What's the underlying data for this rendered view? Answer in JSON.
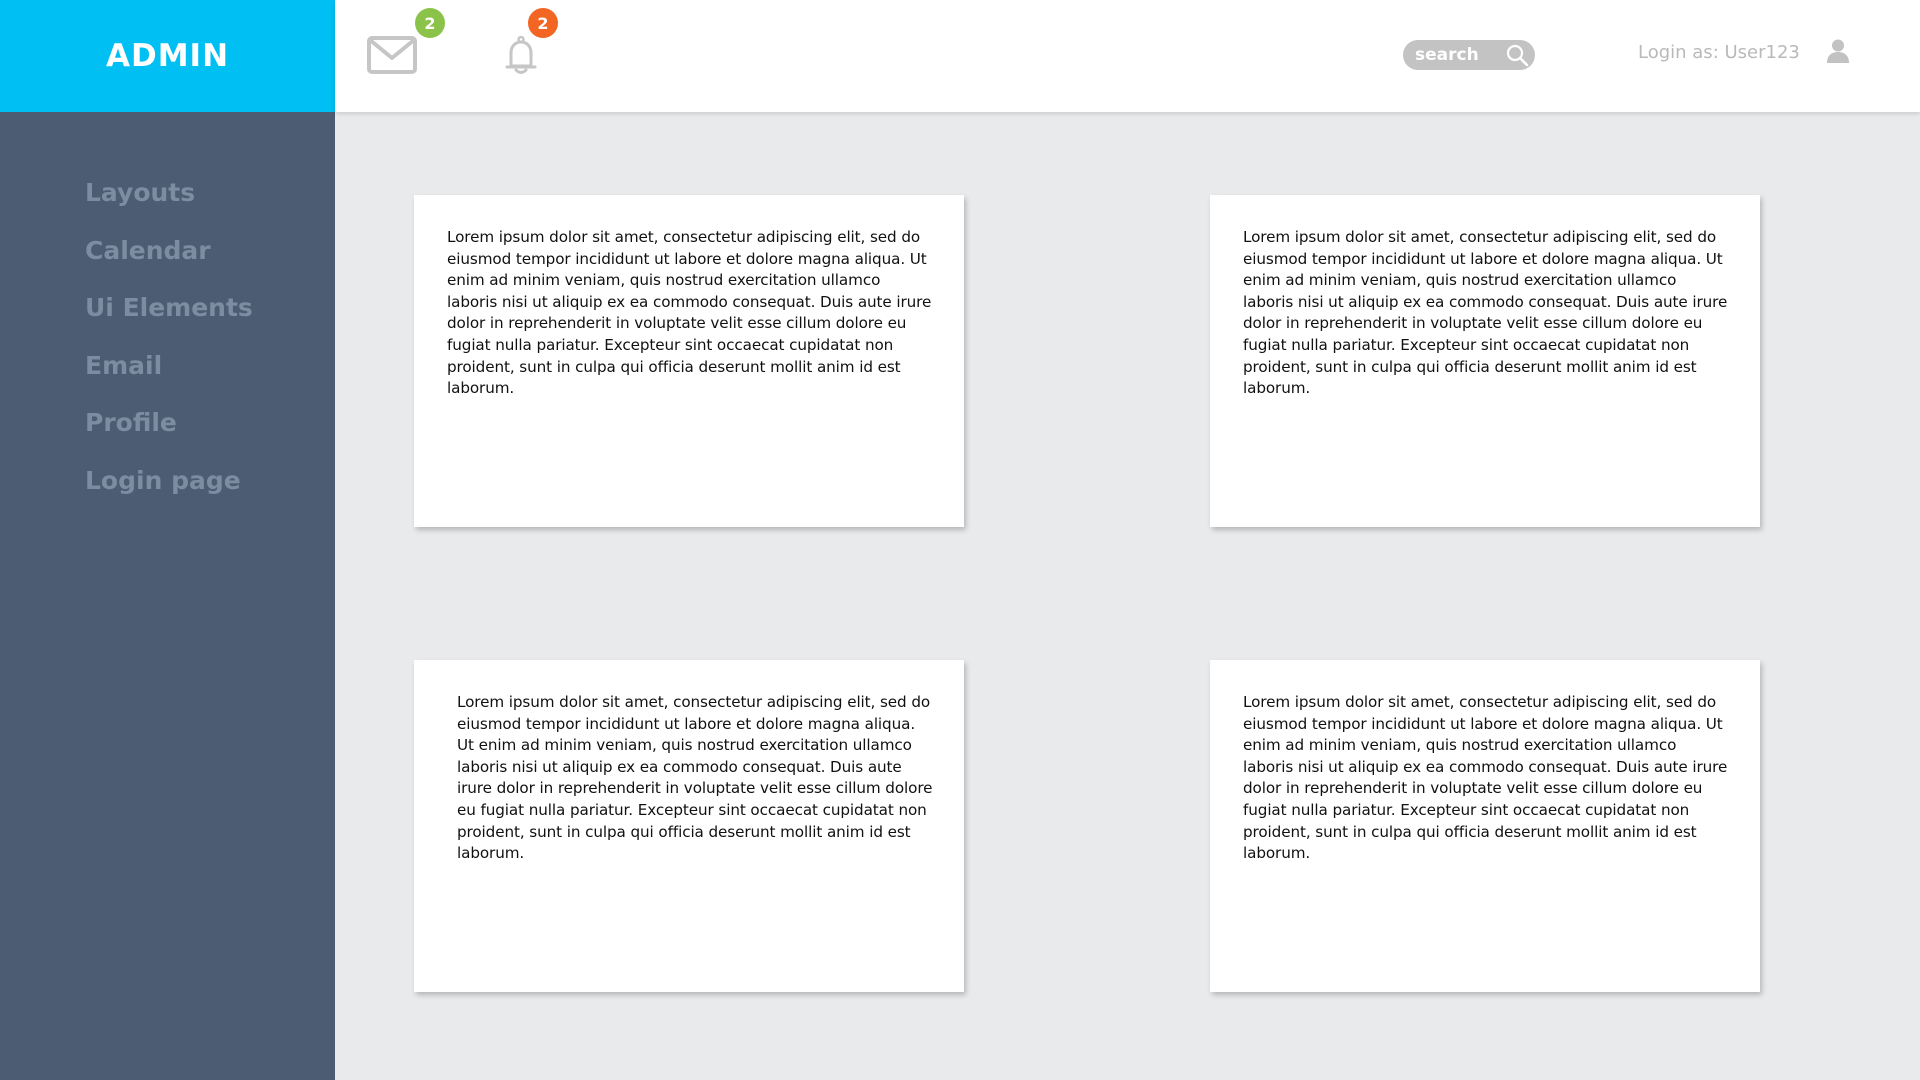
{
  "brand": {
    "title": "ADMIN",
    "color": "#00bff3"
  },
  "header": {
    "mail": {
      "icon": "mail-icon",
      "badge_count": "2",
      "badge_color": "#8bc34a"
    },
    "notifications": {
      "icon": "bell-icon",
      "badge_count": "2",
      "badge_color": "#f26522"
    },
    "search": {
      "placeholder": "search",
      "icon": "search-icon"
    },
    "login_text": "Login as: User123",
    "user_icon": "user-icon"
  },
  "sidebar": {
    "items": [
      {
        "label": "Layouts"
      },
      {
        "label": "Calendar"
      },
      {
        "label": "Ui Elements"
      },
      {
        "label": "Email"
      },
      {
        "label": "Profile"
      },
      {
        "label": "Login page"
      }
    ]
  },
  "cards": [
    {
      "text": "Lorem ipsum dolor sit amet, consectetur adipiscing elit, sed do eiusmod tempor incididunt ut labore et dolore magna aliqua. Ut enim ad minim veniam, quis nostrud exercitation ullamco laboris nisi ut aliquip ex ea commodo consequat. Duis aute irure dolor in reprehenderit in voluptate velit esse cillum dolore eu fugiat nulla pariatur. Excepteur sint occaecat cupidatat non proident, sunt in culpa qui officia deserunt mollit anim id est laborum."
    },
    {
      "text": "Lorem ipsum dolor sit amet, consectetur adipiscing elit, sed do eiusmod tempor incididunt ut labore et dolore magna aliqua. Ut enim ad minim veniam, quis nostrud exercitation ullamco laboris nisi ut aliquip ex ea commodo consequat. Duis aute irure dolor in reprehenderit in voluptate velit esse cillum dolore eu fugiat nulla pariatur. Excepteur sint occaecat cupidatat non proident, sunt in culpa qui officia deserunt mollit anim id est laborum."
    },
    {
      "text": "Lorem ipsum dolor sit amet, consectetur adipiscing elit, sed do eiusmod tempor incididunt ut labore et dolore magna aliqua. Ut enim ad minim veniam, quis nostrud exercitation ullamco laboris nisi ut aliquip ex ea commodo consequat. Duis aute irure dolor in reprehenderit in voluptate velit esse cillum dolore eu fugiat nulla pariatur. Excepteur sint occaecat cupidatat non proident, sunt in culpa qui officia deserunt mollit anim id est laborum."
    },
    {
      "text": "Lorem ipsum dolor sit amet, consectetur adipiscing elit, sed do eiusmod tempor incididunt ut labore et dolore magna aliqua. Ut enim ad minim veniam, quis nostrud exercitation ullamco laboris nisi ut aliquip ex ea commodo consequat. Duis aute irure dolor in reprehenderit in voluptate velit esse cillum dolore eu fugiat nulla pariatur. Excepteur sint occaecat cupidatat non proident, sunt in culpa qui officia deserunt mollit anim id est laborum."
    }
  ]
}
